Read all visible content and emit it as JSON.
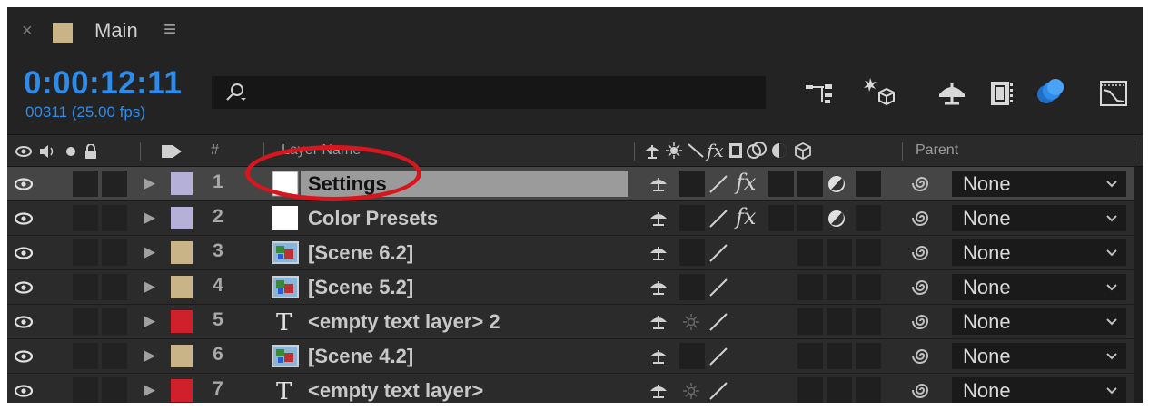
{
  "tab": {
    "title": "Main",
    "swatch_color": "#c8b487"
  },
  "header": {
    "timecode": "0:00:12:11",
    "frames": "00311 (25.00 fps)",
    "search_placeholder": "",
    "accent_color": "#2d8ceb"
  },
  "columns": {
    "layer_name": "Layer Name",
    "number": "#",
    "parent": "Parent"
  },
  "layers": [
    {
      "number": "1",
      "name": "Settings",
      "type": "solid",
      "label_color": "#b4b0d8",
      "selected": true,
      "fx": true,
      "blend": true,
      "parent": "None"
    },
    {
      "number": "2",
      "name": "Color Presets",
      "type": "solid",
      "label_color": "#b4b0d8",
      "selected": false,
      "fx": true,
      "blend": true,
      "parent": "None"
    },
    {
      "number": "3",
      "name": "[Scene 6.2]",
      "type": "comp",
      "label_color": "#c8b487",
      "selected": false,
      "fx": false,
      "blend": false,
      "parent": "None"
    },
    {
      "number": "4",
      "name": "[Scene 5.2]",
      "type": "comp",
      "label_color": "#c8b487",
      "selected": false,
      "fx": false,
      "blend": false,
      "parent": "None"
    },
    {
      "number": "5",
      "name": "<empty text layer> 2",
      "type": "text",
      "label_color": "#d0202c",
      "selected": false,
      "fx": false,
      "blend": false,
      "parent": "None"
    },
    {
      "number": "6",
      "name": "[Scene 4.2]",
      "type": "comp",
      "label_color": "#c8b487",
      "selected": false,
      "fx": false,
      "blend": false,
      "parent": "None"
    },
    {
      "number": "7",
      "name": "<empty text layer>",
      "type": "text",
      "label_color": "#d0202c",
      "selected": false,
      "fx": false,
      "blend": false,
      "parent": "None"
    }
  ],
  "icons": {
    "close": "close-icon",
    "menu": "hamburger-icon",
    "search": "search-icon",
    "header_toolbar": [
      "comp-flowchart-icon",
      "draft-3d-icon",
      "shy-icon",
      "frame-blending-icon",
      "motion-blur-icon",
      "graph-editor-icon"
    ]
  }
}
